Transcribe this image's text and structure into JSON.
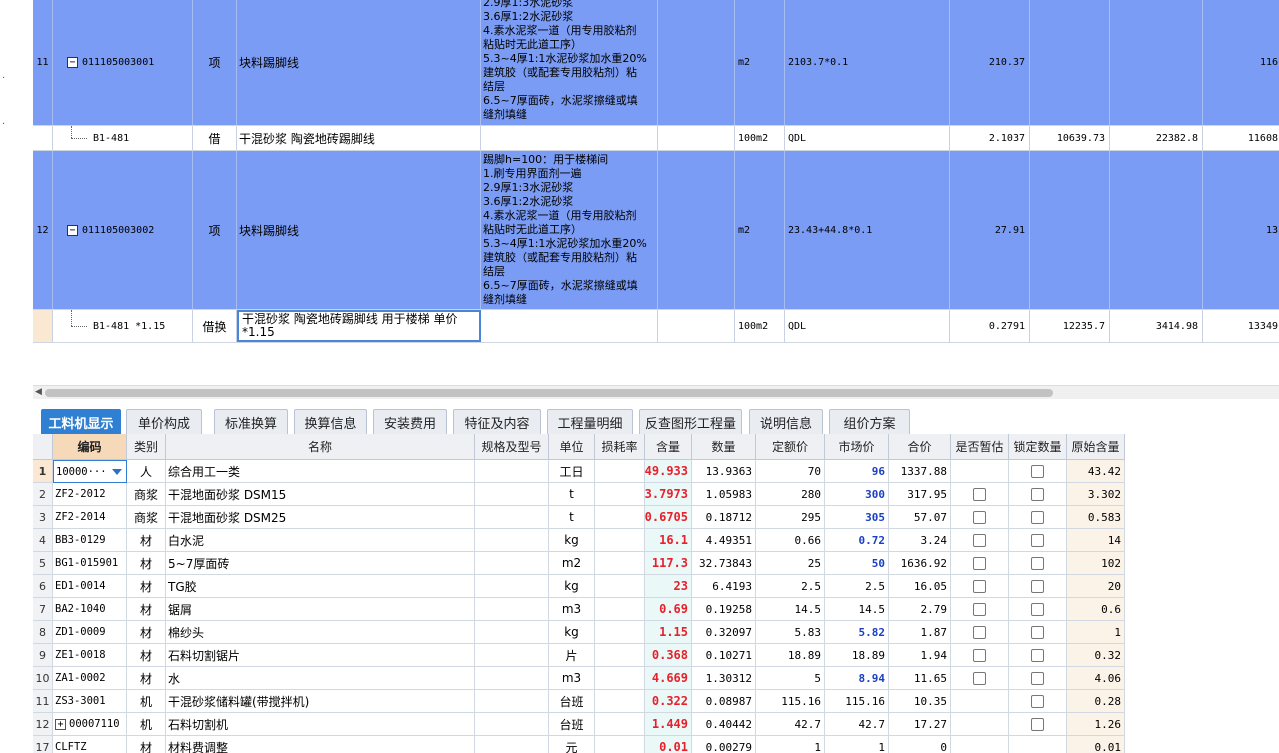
{
  "upper": {
    "rows": [
      {
        "no": "11",
        "code": "011105003001",
        "type": "项",
        "name": "块料踢脚线",
        "desc": [
          "2.9厚1:3水泥砂浆",
          "3.6厚1:2水泥砂浆",
          "4.素水泥浆一道（用专用胶粘剂",
          "粘贴时无此道工序）",
          "5.3~4厚1:1水泥砂浆加水重20%",
          "建筑胶（或配套专用胶粘剂）粘",
          "结层",
          "6.5~7厚面砖，水泥浆擦缝或填",
          "缝剂填缝"
        ],
        "unit": "m2",
        "expr": "2103.7*0.1",
        "qty": "210.37",
        "c1": "",
        "c2": "",
        "c3": "116"
      },
      {
        "no": "",
        "code": "B1-481",
        "type": "借",
        "name": "干混砂浆 陶瓷地砖踢脚线",
        "desc": [],
        "unit": "100m2",
        "expr": "QDL",
        "qty": "2.1037",
        "c1": "10639.73",
        "c2": "22382.8",
        "c3": "11608"
      },
      {
        "no": "12",
        "code": "011105003002",
        "type": "项",
        "name": "块料踢脚线",
        "desc": [
          "踢脚h=100：用于楼梯间",
          "1.刷专用界面剂一遍",
          "2.9厚1:3水泥砂浆",
          "3.6厚1:2水泥砂浆",
          "4.素水泥浆一道（用专用胶粘剂",
          "粘贴时无此道工序）",
          "5.3~4厚1:1水泥砂浆加水重20%",
          "建筑胶（或配套专用胶粘剂）粘",
          "结层",
          "6.5~7厚面砖，水泥浆擦缝或填",
          "缝剂填缝"
        ],
        "unit": "m2",
        "expr": "23.43+44.8*0.1",
        "qty": "27.91",
        "c1": "",
        "c2": "",
        "c3": "13"
      },
      {
        "no": "",
        "code": "B1-481 *1.15",
        "type": "借换",
        "name": "干混砂浆 陶瓷地砖踢脚线  用于楼梯 单价*1.15",
        "desc": [],
        "unit": "100m2",
        "expr": "QDL",
        "qty": "0.2791",
        "c1": "12235.7",
        "c2": "3414.98",
        "c3": "13349"
      }
    ]
  },
  "tabs": [
    "工料机显示",
    "单价构成",
    "标准换算",
    "换算信息",
    "安装费用",
    "特征及内容",
    "工程量明细",
    "反查图形工程量",
    "说明信息",
    "组价方案"
  ],
  "lower": {
    "headers": [
      "",
      "编码",
      "类别",
      "名称",
      "规格及型号",
      "单位",
      "损耗率",
      "含量",
      "数量",
      "定额价",
      "市场价",
      "合价",
      "是否暂估",
      "锁定数量",
      "原始含量"
    ],
    "rows": [
      {
        "rn": "1",
        "code": "10000···",
        "cat": "人",
        "name": "综合用工一类",
        "spec": "",
        "unit": "工日",
        "loss": "",
        "qty": "49.933",
        "num": "13.9363",
        "price": "70",
        "mkt": "96",
        "mktHi": true,
        "total": "1337.88",
        "est": false,
        "lock": true,
        "orig": "43.42"
      },
      {
        "rn": "2",
        "code": "ZF2-2012",
        "cat": "商浆",
        "name": "干混地面砂浆 DSM15",
        "spec": "",
        "unit": "t",
        "loss": "",
        "qty": "3.7973",
        "num": "1.05983",
        "price": "280",
        "mkt": "300",
        "mktHi": true,
        "total": "317.95",
        "est": true,
        "lock": true,
        "orig": "3.302"
      },
      {
        "rn": "3",
        "code": "ZF2-2014",
        "cat": "商浆",
        "name": "干混地面砂浆 DSM25",
        "spec": "",
        "unit": "t",
        "loss": "",
        "qty": "0.6705",
        "num": "0.18712",
        "price": "295",
        "mkt": "305",
        "mktHi": true,
        "total": "57.07",
        "est": true,
        "lock": true,
        "orig": "0.583"
      },
      {
        "rn": "4",
        "code": "BB3-0129",
        "cat": "材",
        "name": "白水泥",
        "spec": "",
        "unit": "kg",
        "loss": "",
        "qty": "16.1",
        "num": "4.49351",
        "price": "0.66",
        "mkt": "0.72",
        "mktHi": true,
        "total": "3.24",
        "est": true,
        "lock": true,
        "orig": "14"
      },
      {
        "rn": "5",
        "code": "BG1-015901",
        "cat": "材",
        "name": "5~7厚面砖",
        "spec": "",
        "unit": "m2",
        "loss": "",
        "qty": "117.3",
        "num": "32.73843",
        "price": "25",
        "mkt": "50",
        "mktHi": true,
        "total": "1636.92",
        "est": true,
        "lock": true,
        "orig": "102"
      },
      {
        "rn": "6",
        "code": "ED1-0014",
        "cat": "材",
        "name": "TG胶",
        "spec": "",
        "unit": "kg",
        "loss": "",
        "qty": "23",
        "num": "6.4193",
        "price": "2.5",
        "mkt": "2.5",
        "mktHi": false,
        "total": "16.05",
        "est": true,
        "lock": true,
        "orig": "20"
      },
      {
        "rn": "7",
        "code": "BA2-1040",
        "cat": "材",
        "name": "锯屑",
        "spec": "",
        "unit": "m3",
        "loss": "",
        "qty": "0.69",
        "num": "0.19258",
        "price": "14.5",
        "mkt": "14.5",
        "mktHi": false,
        "total": "2.79",
        "est": true,
        "lock": true,
        "orig": "0.6"
      },
      {
        "rn": "8",
        "code": "ZD1-0009",
        "cat": "材",
        "name": "棉纱头",
        "spec": "",
        "unit": "kg",
        "loss": "",
        "qty": "1.15",
        "num": "0.32097",
        "price": "5.83",
        "mkt": "5.82",
        "mktHi": true,
        "total": "1.87",
        "est": true,
        "lock": true,
        "orig": "1"
      },
      {
        "rn": "9",
        "code": "ZE1-0018",
        "cat": "材",
        "name": "石料切割锯片",
        "spec": "",
        "unit": "片",
        "loss": "",
        "qty": "0.368",
        "num": "0.10271",
        "price": "18.89",
        "mkt": "18.89",
        "mktHi": false,
        "total": "1.94",
        "est": true,
        "lock": true,
        "orig": "0.32"
      },
      {
        "rn": "10",
        "code": "ZA1-0002",
        "cat": "材",
        "name": "水",
        "spec": "",
        "unit": "m3",
        "loss": "",
        "qty": "4.669",
        "num": "1.30312",
        "price": "5",
        "mkt": "8.94",
        "mktHi": true,
        "total": "11.65",
        "est": true,
        "lock": true,
        "orig": "4.06"
      },
      {
        "rn": "11",
        "code": "ZS3-3001",
        "cat": "机",
        "name": "干混砂浆储料罐(带搅拌机)",
        "spec": "",
        "unit": "台班",
        "loss": "",
        "qty": "0.322",
        "num": "0.08987",
        "price": "115.16",
        "mkt": "115.16",
        "mktHi": false,
        "total": "10.35",
        "est": false,
        "lock": true,
        "orig": "0.28"
      },
      {
        "rn": "12",
        "code": "00007110",
        "cat": "机",
        "name": "石料切割机",
        "spec": "",
        "unit": "台班",
        "loss": "",
        "qty": "1.449",
        "num": "0.40442",
        "price": "42.7",
        "mkt": "42.7",
        "mktHi": false,
        "total": "17.27",
        "est": false,
        "lock": true,
        "orig": "1.26"
      },
      {
        "rn": "17",
        "code": "CLFTZ",
        "cat": "材",
        "name": "材料费调整",
        "spec": "",
        "unit": "元",
        "loss": "",
        "qty": "0.01",
        "num": "0.00279",
        "price": "1",
        "mkt": "1",
        "mktHi": false,
        "total": "0",
        "est": false,
        "lock": false,
        "orig": "0.01"
      }
    ]
  },
  "colors": {
    "selected_row": "#7b9cf5",
    "active_tab": "#2f7fd2",
    "qty_red": "#e8202c",
    "mkt_blue": "#1a3fc4"
  }
}
